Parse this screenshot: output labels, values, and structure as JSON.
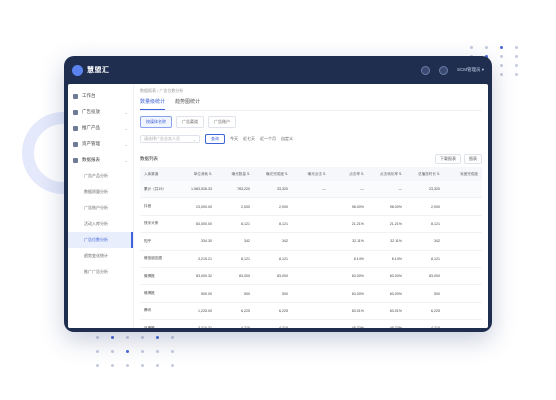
{
  "app": {
    "logo_text": "慧盟汇",
    "user_label": "SCM管理员 ▾"
  },
  "sidebar": {
    "items": [
      {
        "label": "工作台",
        "chevron": ""
      },
      {
        "label": "广告投放",
        "chevron": "⌄"
      },
      {
        "label": "推广产品",
        "chevron": "⌄"
      },
      {
        "label": "资产管理",
        "chevron": "⌄"
      },
      {
        "label": "数据报表",
        "chevron": "⌄"
      },
      {
        "label": "运营管理",
        "chevron": "⌄"
      }
    ],
    "subs": [
      {
        "label": "广告产品分析"
      },
      {
        "label": "数据质量分析"
      },
      {
        "label": "广告账户分析"
      },
      {
        "label": "活动入库分析"
      },
      {
        "label": "广告位数分析"
      },
      {
        "label": "趋势变化统计"
      },
      {
        "label": "推广广告分析"
      }
    ]
  },
  "breadcrumb": "数据报表  /  广告位数分析",
  "tabs": [
    {
      "label": "数量级统计"
    },
    {
      "label": "趋势图统计"
    }
  ],
  "chips": [
    {
      "label": "按媒体名称"
    },
    {
      "label": "广告渠道"
    },
    {
      "label": "广告账户"
    }
  ],
  "filters": {
    "select_placeholder": "请选择广告业务人员",
    "query_label": "查询",
    "today": "今天",
    "last7": "近七天",
    "last30": "近一个月",
    "custom": "自定义"
  },
  "card": {
    "title": "数据列表",
    "export_label": "下载报表",
    "columns_label": "图表"
  },
  "table": {
    "headers": [
      "入库渠道",
      "单位消耗 ⇅",
      "曝光数量 ⇅",
      "曝光完成度 ⇅",
      "曝光点击 ⇅",
      "点击率 ⇅",
      "点击转化率 ⇅",
      "总播放时长 ⇅",
      "深度完成度"
    ],
    "total": [
      "累计（共19）",
      "1,983,526.33",
      "783,220",
      "33,320",
      "—",
      "—",
      "—",
      "23,320",
      ""
    ],
    "rows": [
      [
        "抖音",
        "23,000.00",
        "2,000",
        "2,000",
        "98.00%",
        "98.00%",
        "2,000",
        ""
      ],
      [
        "快手头条",
        "83,000.00",
        "8,121",
        "8,121",
        "21.21%",
        "21.21%",
        "8,121",
        ""
      ],
      [
        "知乎",
        "334.30",
        "342",
        "342",
        "32.11%",
        "32.11%",
        "342",
        ""
      ],
      [
        "微信朋友圈",
        "3,215.21",
        "8,121",
        "8,121",
        "8.14%",
        "8.14%",
        "8,121",
        ""
      ],
      [
        "微博推",
        "83,000.32",
        "83,000",
        "83,000",
        "83.00%",
        "83.00%",
        "83,000",
        ""
      ],
      [
        "微博推",
        "500.00",
        "500",
        "500",
        "83.00%",
        "83.00%",
        "500",
        ""
      ],
      [
        "腾讯",
        "1,225.00",
        "6,225",
        "6,225",
        "83.01%",
        "83.01%",
        "6,225",
        ""
      ],
      [
        "百度推",
        "3,210.31",
        "4,210",
        "4,210",
        "45.32%",
        "45.32%",
        "4,210",
        ""
      ],
      [
        "其他",
        "1,23.05",
        "2,005",
        "2,005",
        "38.38%",
        "38.38%",
        "2,005",
        ""
      ]
    ]
  }
}
